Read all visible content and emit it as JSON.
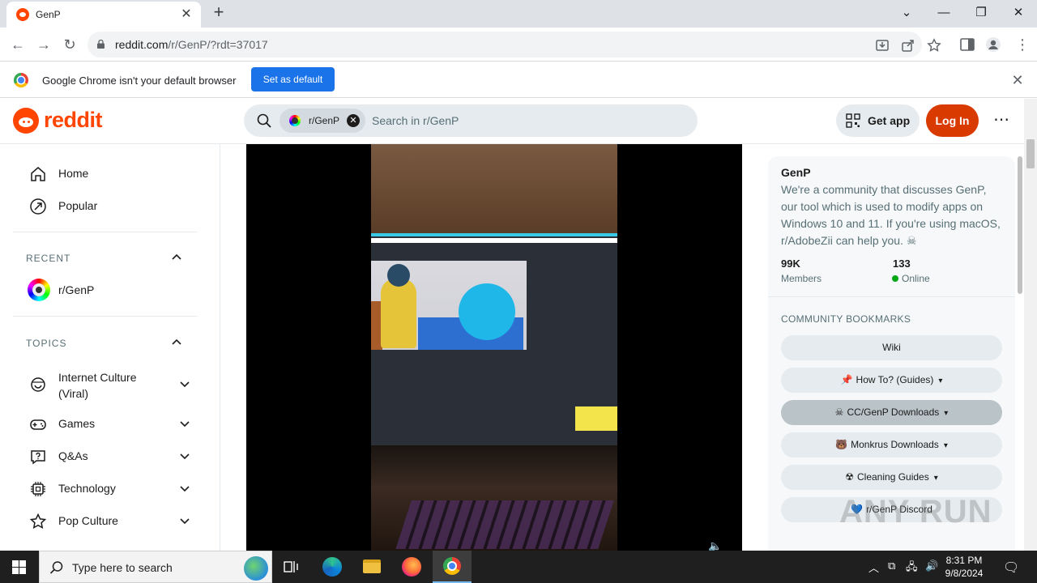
{
  "browser": {
    "tab_title": "GenP",
    "url_host": "reddit.com",
    "url_path": "/r/GenP/?rdt=37017",
    "infobar_message": "Google Chrome isn't your default browser",
    "infobar_button": "Set as default"
  },
  "header": {
    "wordmark": "reddit",
    "search_chip": "r/GenP",
    "search_placeholder": "Search in r/GenP",
    "get_app": "Get app",
    "login": "Log In"
  },
  "left_nav": {
    "top_items": [
      {
        "label": "Home",
        "icon": "home-icon"
      },
      {
        "label": "Popular",
        "icon": "popular-icon"
      }
    ],
    "recent_heading": "RECENT",
    "recent_items": [
      {
        "label": "r/GenP"
      }
    ],
    "topics_heading": "TOPICS",
    "topics": [
      {
        "label": "Internet Culture (Viral)",
        "icon": "smile-icon"
      },
      {
        "label": "Games",
        "icon": "gamepad-icon"
      },
      {
        "label": "Q&As",
        "icon": "question-icon"
      },
      {
        "label": "Technology",
        "icon": "chip-icon"
      },
      {
        "label": "Pop Culture",
        "icon": "star-icon"
      }
    ]
  },
  "community": {
    "name": "GenP",
    "description": "We're a community that discusses GenP, our tool which is used to modify apps on Windows 10 and 11. If you're using macOS, r/AdobeZii can help you. ☠",
    "members_value": "99K",
    "members_label": "Members",
    "online_value": "133",
    "online_label": "Online",
    "bookmarks_heading": "COMMUNITY BOOKMARKS",
    "bookmarks": [
      {
        "emoji": "",
        "label": "Wiki",
        "dropdown": false
      },
      {
        "emoji": "📌",
        "label": "How To? (Guides)",
        "dropdown": true
      },
      {
        "emoji": "☠",
        "label": "CC/GenP Downloads",
        "dropdown": true
      },
      {
        "emoji": "🐻",
        "label": "Monkrus Downloads",
        "dropdown": true
      },
      {
        "emoji": "☢",
        "label": "Cleaning Guides",
        "dropdown": true
      },
      {
        "emoji": "💙",
        "label": "r/GenP Discord",
        "dropdown": false
      }
    ]
  },
  "watermark": "ANY RUN",
  "taskbar": {
    "search_placeholder": "Type here to search",
    "time": "8:31 PM",
    "date": "9/8/2024"
  },
  "colors": {
    "reddit_orange": "#ff4500",
    "login_button": "#d93a00",
    "chrome_blue": "#1a73e8",
    "online_green": "#01a816"
  }
}
